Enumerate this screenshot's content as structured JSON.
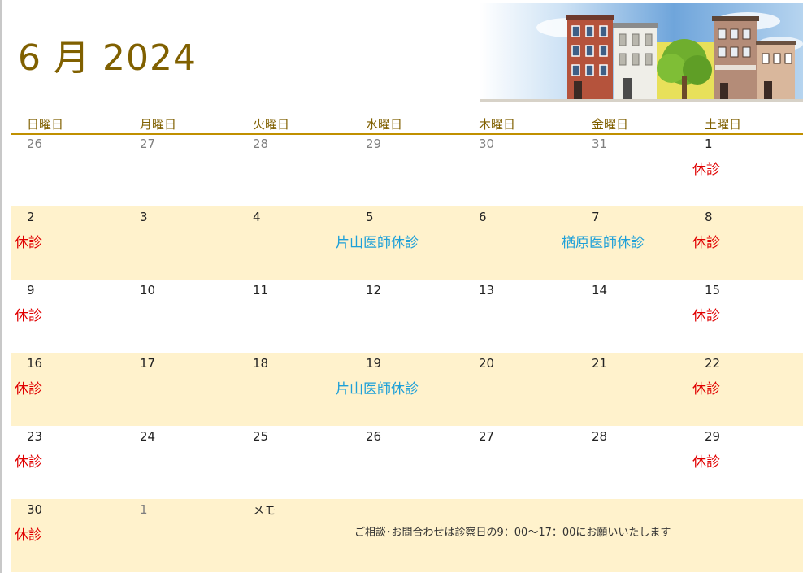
{
  "header": {
    "title": "6 月 2024"
  },
  "weekdays": [
    "日曜日",
    "月曜日",
    "火曜日",
    "水曜日",
    "木曜日",
    "金曜日",
    "土曜日"
  ],
  "weeks": [
    [
      {
        "day": "26",
        "muted": true,
        "note": "",
        "note_type": ""
      },
      {
        "day": "27",
        "muted": true,
        "note": "",
        "note_type": ""
      },
      {
        "day": "28",
        "muted": true,
        "note": "",
        "note_type": ""
      },
      {
        "day": "29",
        "muted": true,
        "note": "",
        "note_type": ""
      },
      {
        "day": "30",
        "muted": true,
        "note": "",
        "note_type": ""
      },
      {
        "day": "31",
        "muted": true,
        "note": "",
        "note_type": ""
      },
      {
        "day": "1",
        "muted": false,
        "note": "休診",
        "note_type": "closed"
      }
    ],
    [
      {
        "day": "2",
        "muted": false,
        "note": "休診",
        "note_type": "closed"
      },
      {
        "day": "3",
        "muted": false,
        "note": "",
        "note_type": ""
      },
      {
        "day": "4",
        "muted": false,
        "note": "",
        "note_type": ""
      },
      {
        "day": "5",
        "muted": false,
        "note": "片山医師休診",
        "note_type": "doctor"
      },
      {
        "day": "6",
        "muted": false,
        "note": "",
        "note_type": ""
      },
      {
        "day": "7",
        "muted": false,
        "note": "楢原医師休診",
        "note_type": "doctor"
      },
      {
        "day": "8",
        "muted": false,
        "note": "休診",
        "note_type": "closed"
      }
    ],
    [
      {
        "day": "9",
        "muted": false,
        "note": "休診",
        "note_type": "closed"
      },
      {
        "day": "10",
        "muted": false,
        "note": "",
        "note_type": ""
      },
      {
        "day": "11",
        "muted": false,
        "note": "",
        "note_type": ""
      },
      {
        "day": "12",
        "muted": false,
        "note": "",
        "note_type": ""
      },
      {
        "day": "13",
        "muted": false,
        "note": "",
        "note_type": ""
      },
      {
        "day": "14",
        "muted": false,
        "note": "",
        "note_type": ""
      },
      {
        "day": "15",
        "muted": false,
        "note": "休診",
        "note_type": "closed"
      }
    ],
    [
      {
        "day": "16",
        "muted": false,
        "note": "休診",
        "note_type": "closed"
      },
      {
        "day": "17",
        "muted": false,
        "note": "",
        "note_type": ""
      },
      {
        "day": "18",
        "muted": false,
        "note": "",
        "note_type": ""
      },
      {
        "day": "19",
        "muted": false,
        "note": "片山医師休診",
        "note_type": "doctor"
      },
      {
        "day": "20",
        "muted": false,
        "note": "",
        "note_type": ""
      },
      {
        "day": "21",
        "muted": false,
        "note": "",
        "note_type": ""
      },
      {
        "day": "22",
        "muted": false,
        "note": "休診",
        "note_type": "closed"
      }
    ],
    [
      {
        "day": "23",
        "muted": false,
        "note": "休診",
        "note_type": "closed"
      },
      {
        "day": "24",
        "muted": false,
        "note": "",
        "note_type": ""
      },
      {
        "day": "25",
        "muted": false,
        "note": "",
        "note_type": ""
      },
      {
        "day": "26",
        "muted": false,
        "note": "",
        "note_type": ""
      },
      {
        "day": "27",
        "muted": false,
        "note": "",
        "note_type": ""
      },
      {
        "day": "28",
        "muted": false,
        "note": "",
        "note_type": ""
      },
      {
        "day": "29",
        "muted": false,
        "note": "休診",
        "note_type": "closed"
      }
    ]
  ],
  "last_week": {
    "days": [
      {
        "day": "30",
        "muted": false,
        "note": "休診",
        "note_type": "closed"
      },
      {
        "day": "1",
        "muted": true,
        "note": "",
        "note_type": ""
      }
    ],
    "memo_label": "メモ",
    "memo_text": "ご相談･お問合わせは診察日の9：00～17：00にお願いいたします"
  },
  "colors": {
    "title": "#806000",
    "rule": "#c09000",
    "shade": "#fff2cc",
    "closed": "#e00000",
    "doctor": "#1ea0d8"
  },
  "banner": {
    "icon": "townhouses-street-illustration"
  }
}
